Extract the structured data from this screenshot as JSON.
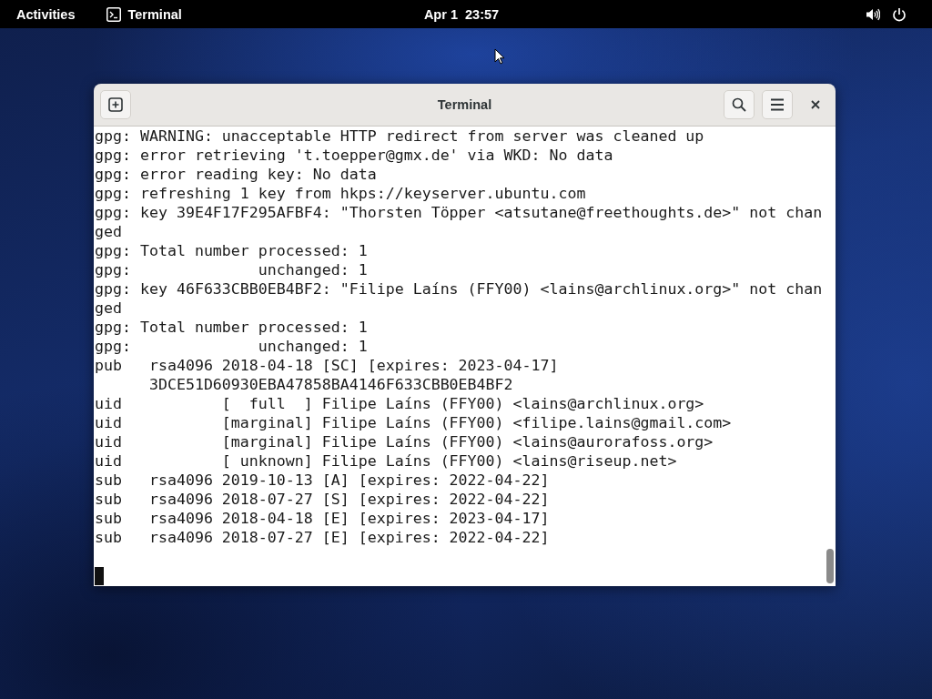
{
  "top_bar": {
    "activities": "Activities",
    "app_menu": "Terminal",
    "clock": "Apr 1  23:57"
  },
  "window": {
    "title": "Terminal",
    "lines": [
      "gpg: WARNING: unacceptable HTTP redirect from server was cleaned up",
      "gpg: error retrieving 't.toepper@gmx.de' via WKD: No data",
      "gpg: error reading key: No data",
      "gpg: refreshing 1 key from hkps://keyserver.ubuntu.com",
      "gpg: key 39E4F17F295AFBF4: \"Thorsten Töpper <atsutane@freethoughts.de>\" not chan",
      "ged",
      "gpg: Total number processed: 1",
      "gpg:              unchanged: 1",
      "gpg: key 46F633CBB0EB4BF2: \"Filipe Laíns (FFY00) <lains@archlinux.org>\" not chan",
      "ged",
      "gpg: Total number processed: 1",
      "gpg:              unchanged: 1",
      "pub   rsa4096 2018-04-18 [SC] [expires: 2023-04-17]",
      "      3DCE51D60930EBA47858BA4146F633CBB0EB4BF2",
      "uid           [  full  ] Filipe Laíns (FFY00) <lains@archlinux.org>",
      "uid           [marginal] Filipe Laíns (FFY00) <filipe.lains@gmail.com>",
      "uid           [marginal] Filipe Laíns (FFY00) <lains@aurorafoss.org>",
      "uid           [ unknown] Filipe Laíns (FFY00) <lains@riseup.net>",
      "sub   rsa4096 2019-10-13 [A] [expires: 2022-04-22]",
      "sub   rsa4096 2018-07-27 [S] [expires: 2022-04-22]",
      "sub   rsa4096 2018-04-18 [E] [expires: 2023-04-17]",
      "sub   rsa4096 2018-07-27 [E] [expires: 2022-04-22]"
    ]
  }
}
